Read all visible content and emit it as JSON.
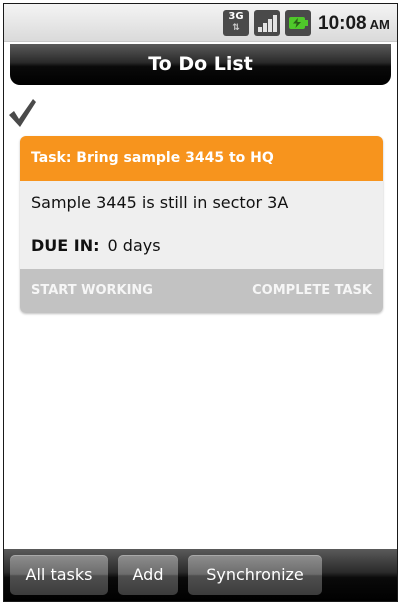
{
  "status_bar": {
    "network_label": "3G",
    "network_icon": "network-3g-icon",
    "signal_icon": "signal-strength-icon",
    "battery_icon": "battery-charging-icon",
    "time": "10:08",
    "ampm": "AM"
  },
  "header": {
    "title": "To Do List"
  },
  "filter_indicator": {
    "icon": "checkmark-icon"
  },
  "task": {
    "title": "Task: Bring sample 3445 to HQ",
    "description": "Sample 3445 is still in sector 3A",
    "due_label": "DUE IN:",
    "due_value": "0 days",
    "start_label": "START WORKING",
    "complete_label": "COMPLETE TASK",
    "accent_color": "#f7941d"
  },
  "toolbar": {
    "all_tasks_label": "All tasks",
    "add_label": "Add",
    "sync_label": "Synchronize"
  }
}
